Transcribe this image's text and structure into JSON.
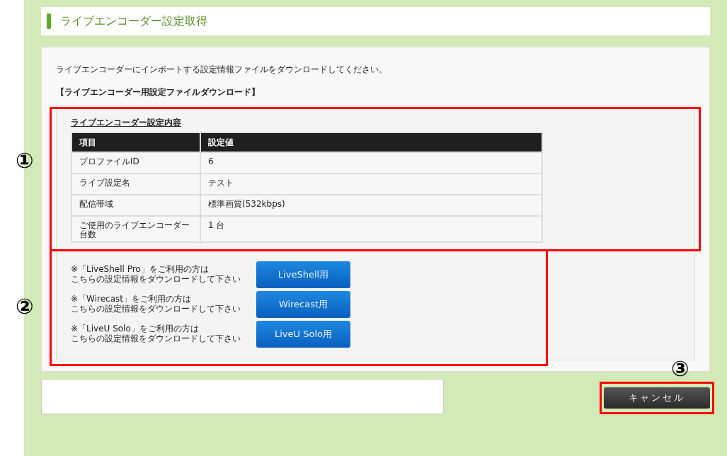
{
  "header": {
    "title": "ライブエンコーダー設定取得"
  },
  "intro": "ライブエンコーダーにインポートする設定情報ファイルをダウンロードしてください。",
  "section_title": "【ライブエンコーダー用設定ファイルダウンロード】",
  "settings": {
    "title": "ライブエンコーダー設定内容",
    "columns": [
      "項目",
      "設定値"
    ],
    "rows": [
      [
        "プロファイルID",
        "6"
      ],
      [
        "ライブ設定名",
        "テスト"
      ],
      [
        "配信帯域",
        "標準画質(532kbps)"
      ],
      [
        "ご使用のライブエンコーダー台数",
        "1 台"
      ]
    ]
  },
  "downloads": [
    {
      "note_line1": "※「LiveShell Pro」をご利用の方は",
      "note_line2": "こちらの設定情報をダウンロードして下さい",
      "button": "LiveShell用"
    },
    {
      "note_line1": "※「Wirecast」をご利用の方は",
      "note_line2": "こちらの設定情報をダウンロードして下さい",
      "button": "Wirecast用"
    },
    {
      "note_line1": "※「LiveU Solo」をご利用の方は",
      "note_line2": "こちらの設定情報をダウンロードして下さい",
      "button": "LiveU Solo用"
    }
  ],
  "cancel_button": "キャンセル",
  "annotations": [
    {
      "label": "①"
    },
    {
      "label": "②"
    },
    {
      "label": "③"
    }
  ]
}
